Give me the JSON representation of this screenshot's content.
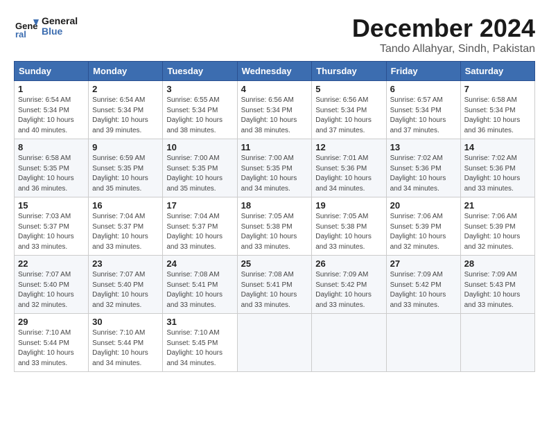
{
  "header": {
    "logo_text_general": "General",
    "logo_text_blue": "Blue",
    "month_title": "December 2024",
    "location": "Tando Allahyar, Sindh, Pakistan"
  },
  "weekdays": [
    "Sunday",
    "Monday",
    "Tuesday",
    "Wednesday",
    "Thursday",
    "Friday",
    "Saturday"
  ],
  "weeks": [
    [
      {
        "day": "1",
        "info": "Sunrise: 6:54 AM\nSunset: 5:34 PM\nDaylight: 10 hours\nand 40 minutes."
      },
      {
        "day": "2",
        "info": "Sunrise: 6:54 AM\nSunset: 5:34 PM\nDaylight: 10 hours\nand 39 minutes."
      },
      {
        "day": "3",
        "info": "Sunrise: 6:55 AM\nSunset: 5:34 PM\nDaylight: 10 hours\nand 38 minutes."
      },
      {
        "day": "4",
        "info": "Sunrise: 6:56 AM\nSunset: 5:34 PM\nDaylight: 10 hours\nand 38 minutes."
      },
      {
        "day": "5",
        "info": "Sunrise: 6:56 AM\nSunset: 5:34 PM\nDaylight: 10 hours\nand 37 minutes."
      },
      {
        "day": "6",
        "info": "Sunrise: 6:57 AM\nSunset: 5:34 PM\nDaylight: 10 hours\nand 37 minutes."
      },
      {
        "day": "7",
        "info": "Sunrise: 6:58 AM\nSunset: 5:34 PM\nDaylight: 10 hours\nand 36 minutes."
      }
    ],
    [
      {
        "day": "8",
        "info": "Sunrise: 6:58 AM\nSunset: 5:35 PM\nDaylight: 10 hours\nand 36 minutes."
      },
      {
        "day": "9",
        "info": "Sunrise: 6:59 AM\nSunset: 5:35 PM\nDaylight: 10 hours\nand 35 minutes."
      },
      {
        "day": "10",
        "info": "Sunrise: 7:00 AM\nSunset: 5:35 PM\nDaylight: 10 hours\nand 35 minutes."
      },
      {
        "day": "11",
        "info": "Sunrise: 7:00 AM\nSunset: 5:35 PM\nDaylight: 10 hours\nand 34 minutes."
      },
      {
        "day": "12",
        "info": "Sunrise: 7:01 AM\nSunset: 5:36 PM\nDaylight: 10 hours\nand 34 minutes."
      },
      {
        "day": "13",
        "info": "Sunrise: 7:02 AM\nSunset: 5:36 PM\nDaylight: 10 hours\nand 34 minutes."
      },
      {
        "day": "14",
        "info": "Sunrise: 7:02 AM\nSunset: 5:36 PM\nDaylight: 10 hours\nand 33 minutes."
      }
    ],
    [
      {
        "day": "15",
        "info": "Sunrise: 7:03 AM\nSunset: 5:37 PM\nDaylight: 10 hours\nand 33 minutes."
      },
      {
        "day": "16",
        "info": "Sunrise: 7:04 AM\nSunset: 5:37 PM\nDaylight: 10 hours\nand 33 minutes."
      },
      {
        "day": "17",
        "info": "Sunrise: 7:04 AM\nSunset: 5:37 PM\nDaylight: 10 hours\nand 33 minutes."
      },
      {
        "day": "18",
        "info": "Sunrise: 7:05 AM\nSunset: 5:38 PM\nDaylight: 10 hours\nand 33 minutes."
      },
      {
        "day": "19",
        "info": "Sunrise: 7:05 AM\nSunset: 5:38 PM\nDaylight: 10 hours\nand 33 minutes."
      },
      {
        "day": "20",
        "info": "Sunrise: 7:06 AM\nSunset: 5:39 PM\nDaylight: 10 hours\nand 32 minutes."
      },
      {
        "day": "21",
        "info": "Sunrise: 7:06 AM\nSunset: 5:39 PM\nDaylight: 10 hours\nand 32 minutes."
      }
    ],
    [
      {
        "day": "22",
        "info": "Sunrise: 7:07 AM\nSunset: 5:40 PM\nDaylight: 10 hours\nand 32 minutes."
      },
      {
        "day": "23",
        "info": "Sunrise: 7:07 AM\nSunset: 5:40 PM\nDaylight: 10 hours\nand 32 minutes."
      },
      {
        "day": "24",
        "info": "Sunrise: 7:08 AM\nSunset: 5:41 PM\nDaylight: 10 hours\nand 33 minutes."
      },
      {
        "day": "25",
        "info": "Sunrise: 7:08 AM\nSunset: 5:41 PM\nDaylight: 10 hours\nand 33 minutes."
      },
      {
        "day": "26",
        "info": "Sunrise: 7:09 AM\nSunset: 5:42 PM\nDaylight: 10 hours\nand 33 minutes."
      },
      {
        "day": "27",
        "info": "Sunrise: 7:09 AM\nSunset: 5:42 PM\nDaylight: 10 hours\nand 33 minutes."
      },
      {
        "day": "28",
        "info": "Sunrise: 7:09 AM\nSunset: 5:43 PM\nDaylight: 10 hours\nand 33 minutes."
      }
    ],
    [
      {
        "day": "29",
        "info": "Sunrise: 7:10 AM\nSunset: 5:44 PM\nDaylight: 10 hours\nand 33 minutes."
      },
      {
        "day": "30",
        "info": "Sunrise: 7:10 AM\nSunset: 5:44 PM\nDaylight: 10 hours\nand 34 minutes."
      },
      {
        "day": "31",
        "info": "Sunrise: 7:10 AM\nSunset: 5:45 PM\nDaylight: 10 hours\nand 34 minutes."
      },
      null,
      null,
      null,
      null
    ]
  ]
}
